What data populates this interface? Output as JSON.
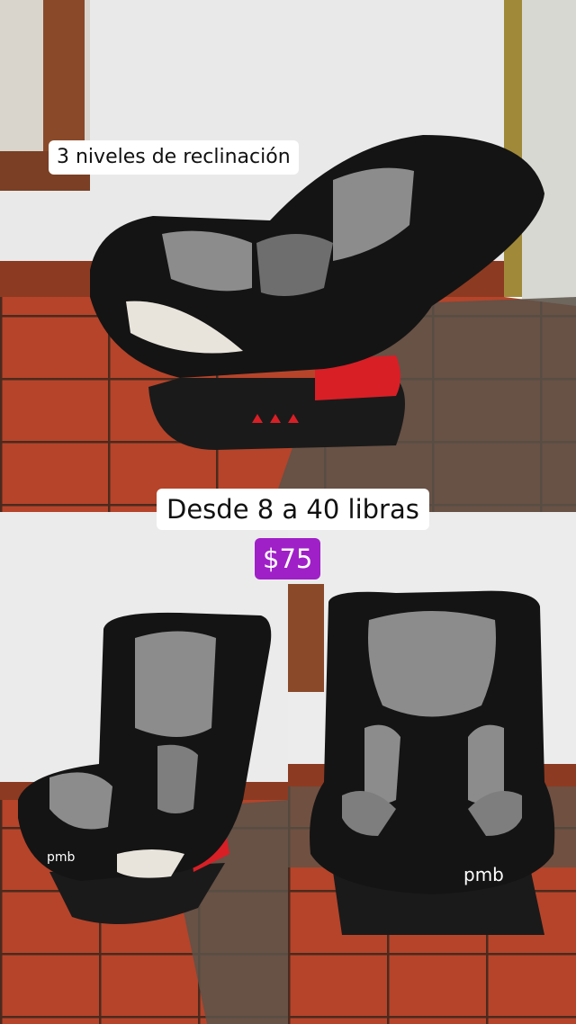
{
  "captions": {
    "recline_levels": "3 niveles de reclinación",
    "weight_range": "Desde 8 a 40 libras",
    "price": "$75"
  },
  "colors": {
    "price_badge": "#a020c8",
    "caption_background": "#ffffff",
    "tile_floor": "#b5442a",
    "seat_black": "#141414",
    "seat_gray": "#8c8c8c",
    "seat_red_accent": "#d81f26"
  },
  "photos": [
    {
      "subject": "infant-car-seat-reclined-side-view"
    },
    {
      "subject": "infant-car-seat-three-quarter-view"
    },
    {
      "subject": "infant-car-seat-front-view"
    }
  ],
  "brand_marks": {
    "seat_logo": "pmb"
  }
}
